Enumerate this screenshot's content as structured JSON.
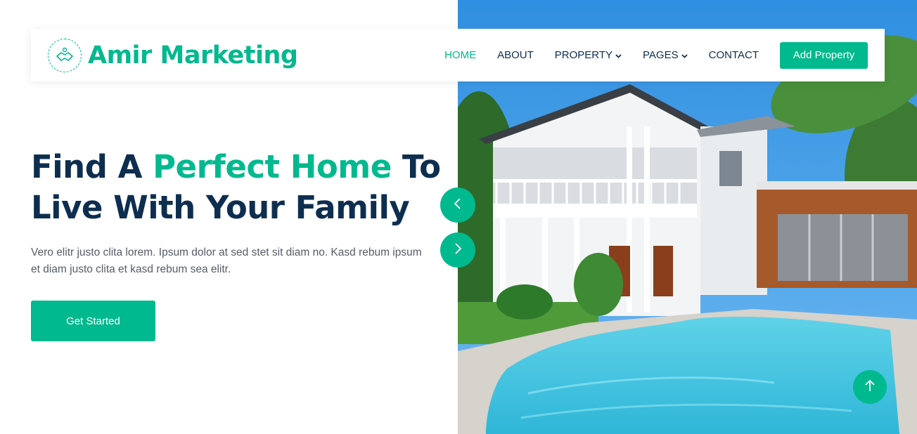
{
  "brand": {
    "name": "Amir Marketing",
    "icon": "handshake-icon",
    "color": "#00b98e"
  },
  "nav": {
    "items": [
      {
        "label": "HOME",
        "active": true
      },
      {
        "label": "ABOUT",
        "active": false
      },
      {
        "label": "PROPERTY",
        "active": false,
        "dropdown": true
      },
      {
        "label": "PAGES",
        "active": false,
        "dropdown": true
      },
      {
        "label": "CONTACT",
        "active": false
      }
    ],
    "cta_label": "Add Property"
  },
  "hero": {
    "title_part1": "Find A ",
    "title_accent": "Perfect Home",
    "title_part2": " To Live With Your Family",
    "description": "Vero elitr justo clita lorem. Ipsum dolor at sed stet sit diam no. Kasd rebum ipsum et diam justo clita et kasd rebum sea elitr.",
    "button_label": "Get Started",
    "image": "house-with-pool-image"
  },
  "carousel": {
    "prev_icon": "chevron-left-icon",
    "next_icon": "chevron-right-icon"
  },
  "back_to_top_icon": "arrow-up-icon",
  "colors": {
    "primary": "#00b98e",
    "dark": "#0e2e50",
    "text": "#555d66"
  }
}
